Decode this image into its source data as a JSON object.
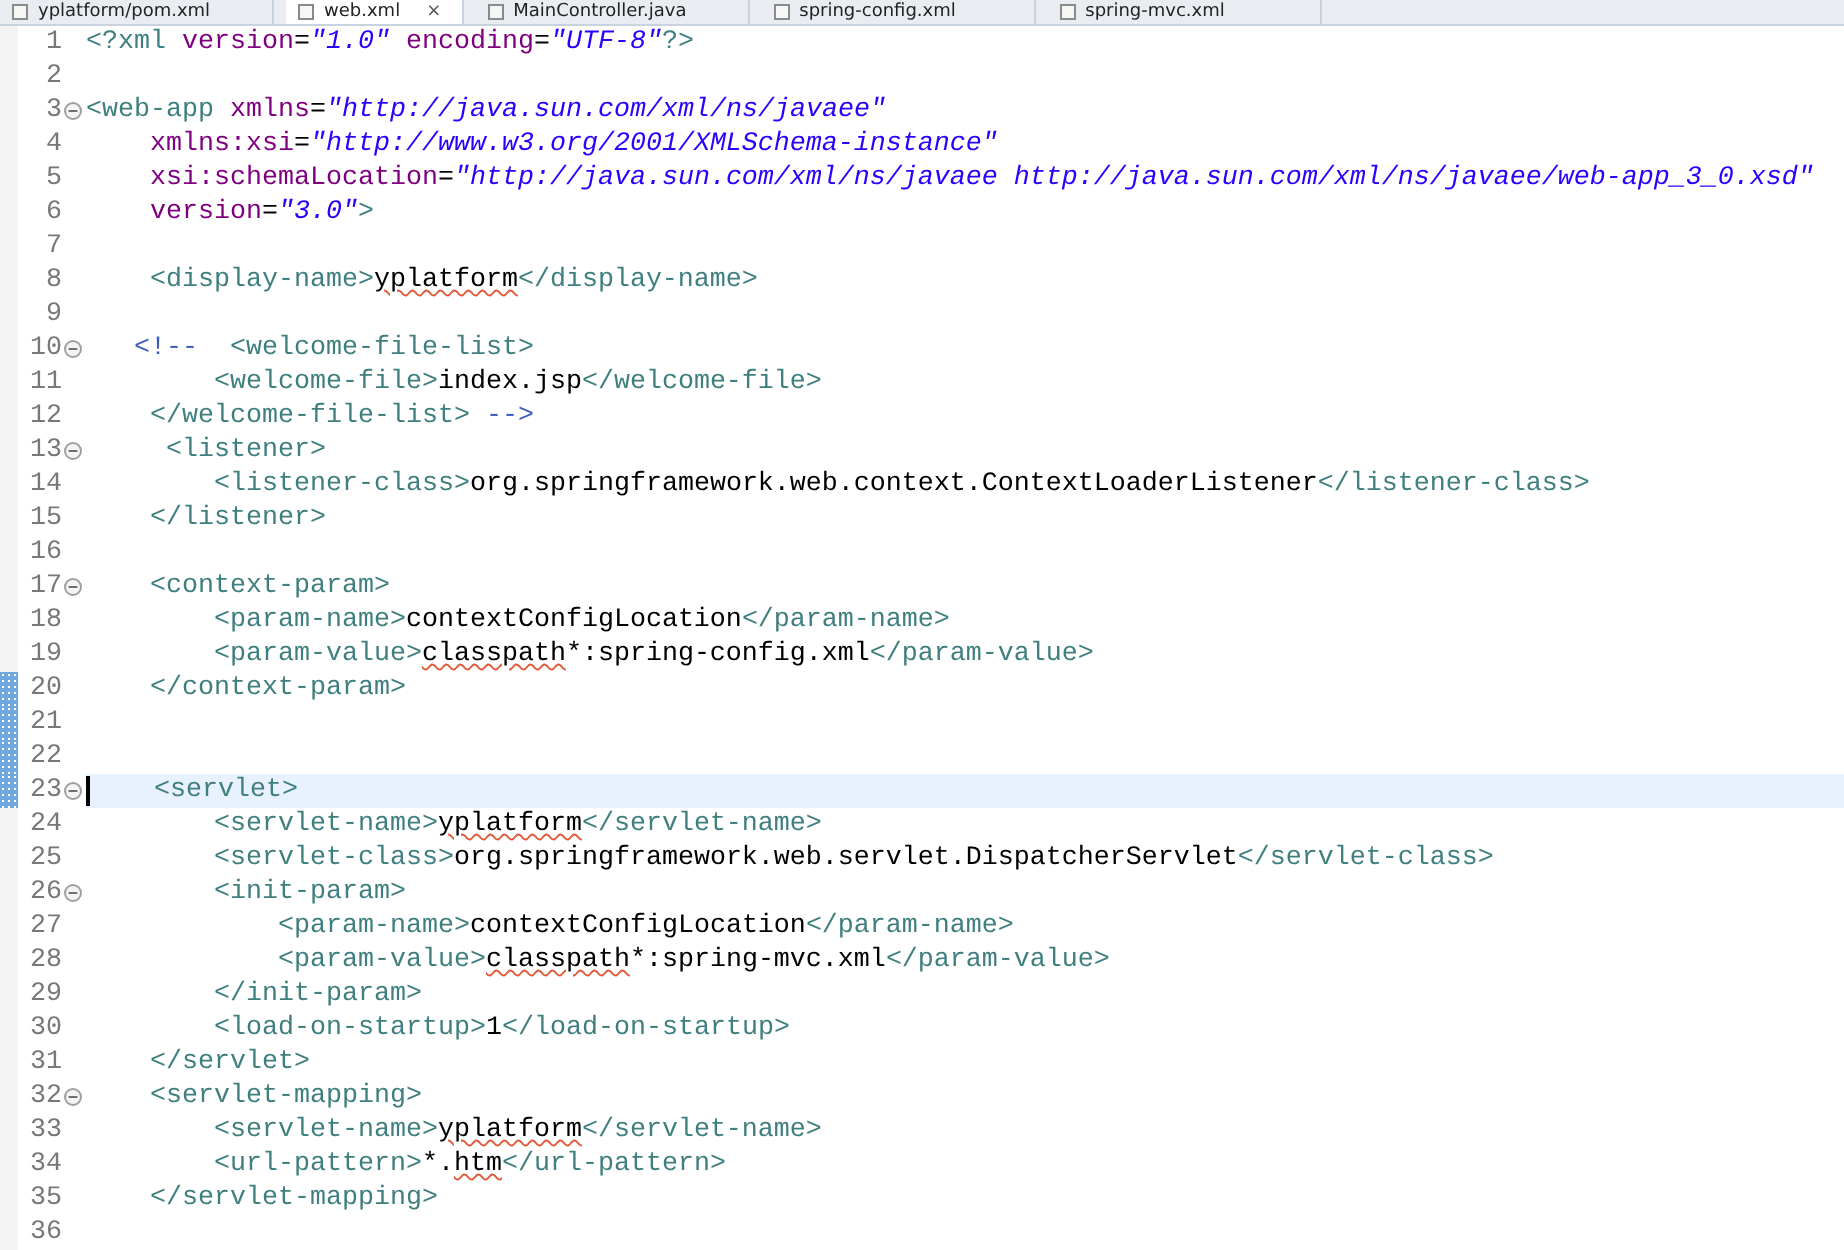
{
  "tabs": [
    {
      "label": "yplatform/pom.xml",
      "selected": false
    },
    {
      "label": "web.xml",
      "selected": true,
      "close": "×"
    },
    {
      "label": "MainController.java",
      "selected": false
    },
    {
      "label": "spring-config.xml",
      "selected": false
    },
    {
      "label": "spring-mvc.xml",
      "selected": false
    }
  ],
  "editor": {
    "lines": [
      {
        "number": "1",
        "tokens": [
          {
            "kind": "tag",
            "text": "<?xml"
          },
          {
            "kind": "attr",
            "text": " version"
          },
          {
            "kind": "text",
            "text": "="
          },
          {
            "kind": "value",
            "text": "\"1.0\""
          },
          {
            "kind": "attr",
            "text": " encoding"
          },
          {
            "kind": "text",
            "text": "="
          },
          {
            "kind": "value",
            "text": "\"UTF-8\""
          },
          {
            "kind": "tag",
            "text": "?>"
          }
        ]
      },
      {
        "number": "2"
      },
      {
        "number": "3",
        "foldable": true,
        "tokens": [
          {
            "kind": "tag",
            "text": "<web-app"
          },
          {
            "kind": "attr",
            "text": " xmlns"
          },
          {
            "kind": "text",
            "text": "="
          },
          {
            "kind": "value",
            "text": "\"http://java.sun.com/xml/ns/javaee\""
          }
        ]
      },
      {
        "number": "4",
        "tokens": [
          {
            "kind": "attr",
            "text": "    xmlns:xsi"
          },
          {
            "kind": "text",
            "text": "="
          },
          {
            "kind": "value",
            "text": "\"http://www.w3.org/2001/XMLSchema-instance\""
          }
        ]
      },
      {
        "number": "5",
        "tokens": [
          {
            "kind": "attr",
            "text": "    xsi:schemaLocation"
          },
          {
            "kind": "text",
            "text": "="
          },
          {
            "kind": "value",
            "text": "\"http://java.sun.com/xml/ns/javaee http://java.sun.com/xml/ns/javaee/web-app_3_0.xsd\""
          }
        ]
      },
      {
        "number": "6",
        "tokens": [
          {
            "kind": "attr",
            "text": "    version"
          },
          {
            "kind": "text",
            "text": "="
          },
          {
            "kind": "value",
            "text": "\"3.0\""
          },
          {
            "kind": "tag",
            "text": ">"
          }
        ]
      },
      {
        "number": "7"
      },
      {
        "number": "8",
        "tokens": [
          {
            "kind": "tag",
            "text": "    <display-name>"
          },
          {
            "kind": "misspelled",
            "text": "yplatform"
          },
          {
            "kind": "tag",
            "text": "</display-name>"
          }
        ]
      },
      {
        "number": "9"
      },
      {
        "number": "10",
        "foldable": true,
        "tokens": [
          {
            "kind": "comment",
            "text": "   <!--"
          },
          {
            "kind": "tag",
            "text": "  <welcome-file-list>"
          }
        ]
      },
      {
        "number": "11",
        "tokens": [
          {
            "kind": "tag",
            "text": "        <welcome-file>"
          },
          {
            "kind": "text",
            "text": "index.jsp"
          },
          {
            "kind": "tag",
            "text": "</welcome-file>"
          }
        ]
      },
      {
        "number": "12",
        "tokens": [
          {
            "kind": "tag",
            "text": "    </welcome-file-list>"
          },
          {
            "kind": "comment",
            "text": " -->"
          }
        ]
      },
      {
        "number": "13",
        "foldable": true,
        "tokens": [
          {
            "kind": "tag",
            "text": "     <listener>"
          }
        ]
      },
      {
        "number": "14",
        "tokens": [
          {
            "kind": "tag",
            "text": "        <listener-class>"
          },
          {
            "kind": "text",
            "text": "org.springframework.web.context.ContextLoaderListener"
          },
          {
            "kind": "tag",
            "text": "</listener-class>"
          }
        ]
      },
      {
        "number": "15",
        "tokens": [
          {
            "kind": "tag",
            "text": "    </listener>"
          }
        ]
      },
      {
        "number": "16"
      },
      {
        "number": "17",
        "foldable": true,
        "tokens": [
          {
            "kind": "tag",
            "text": "    <context-param>"
          }
        ]
      },
      {
        "number": "18",
        "tokens": [
          {
            "kind": "tag",
            "text": "        <param-name>"
          },
          {
            "kind": "text",
            "text": "contextConfigLocation"
          },
          {
            "kind": "tag",
            "text": "</param-name>"
          }
        ]
      },
      {
        "number": "19",
        "tokens": [
          {
            "kind": "tag",
            "text": "        <param-value>"
          },
          {
            "kind": "misspelled",
            "text": "classpath"
          },
          {
            "kind": "text",
            "text": "*:spring-config.xml"
          },
          {
            "kind": "tag",
            "text": "</param-value>"
          }
        ]
      },
      {
        "number": "20",
        "changed": true,
        "tokens": [
          {
            "kind": "tag",
            "text": "    </context-param>"
          }
        ]
      },
      {
        "number": "21",
        "changed": true
      },
      {
        "number": "22",
        "changed": true
      },
      {
        "number": "23",
        "changed": true,
        "foldable": true,
        "current": true,
        "tokens": [
          {
            "kind": "tag",
            "text": "    <servlet>"
          }
        ]
      },
      {
        "number": "24",
        "tokens": [
          {
            "kind": "tag",
            "text": "        <servlet-name>"
          },
          {
            "kind": "misspelled",
            "text": "yplatform"
          },
          {
            "kind": "tag",
            "text": "</servlet-name>"
          }
        ]
      },
      {
        "number": "25",
        "tokens": [
          {
            "kind": "tag",
            "text": "        <servlet-class>"
          },
          {
            "kind": "text",
            "text": "org.springframework.web.servlet.DispatcherServlet"
          },
          {
            "kind": "tag",
            "text": "</servlet-class>"
          }
        ]
      },
      {
        "number": "26",
        "foldable": true,
        "tokens": [
          {
            "kind": "tag",
            "text": "        <init-param>"
          }
        ]
      },
      {
        "number": "27",
        "tokens": [
          {
            "kind": "tag",
            "text": "            <param-name>"
          },
          {
            "kind": "text",
            "text": "contextConfigLocation"
          },
          {
            "kind": "tag",
            "text": "</param-name>"
          }
        ]
      },
      {
        "number": "28",
        "tokens": [
          {
            "kind": "tag",
            "text": "            <param-value>"
          },
          {
            "kind": "misspelled",
            "text": "classpath"
          },
          {
            "kind": "text",
            "text": "*:spring-mvc.xml"
          },
          {
            "kind": "tag",
            "text": "</param-value>"
          }
        ]
      },
      {
        "number": "29",
        "tokens": [
          {
            "kind": "tag",
            "text": "        </init-param>"
          }
        ]
      },
      {
        "number": "30",
        "tokens": [
          {
            "kind": "tag",
            "text": "        <load-on-startup>"
          },
          {
            "kind": "text",
            "text": "1"
          },
          {
            "kind": "tag",
            "text": "</load-on-startup>"
          }
        ]
      },
      {
        "number": "31",
        "tokens": [
          {
            "kind": "tag",
            "text": "    </servlet>"
          }
        ]
      },
      {
        "number": "32",
        "foldable": true,
        "tokens": [
          {
            "kind": "tag",
            "text": "    <servlet-mapping>"
          }
        ]
      },
      {
        "number": "33",
        "tokens": [
          {
            "kind": "tag",
            "text": "        <servlet-name>"
          },
          {
            "kind": "misspelled",
            "text": "yplatform"
          },
          {
            "kind": "tag",
            "text": "</servlet-name>"
          }
        ]
      },
      {
        "number": "34",
        "tokens": [
          {
            "kind": "tag",
            "text": "        <url-pattern>"
          },
          {
            "kind": "text",
            "text": "*."
          },
          {
            "kind": "misspelled",
            "text": "htm"
          },
          {
            "kind": "tag",
            "text": "</url-pattern>"
          }
        ]
      },
      {
        "number": "35",
        "tokens": [
          {
            "kind": "tag",
            "text": "    </servlet-mapping>"
          }
        ]
      },
      {
        "number": "36"
      }
    ]
  }
}
